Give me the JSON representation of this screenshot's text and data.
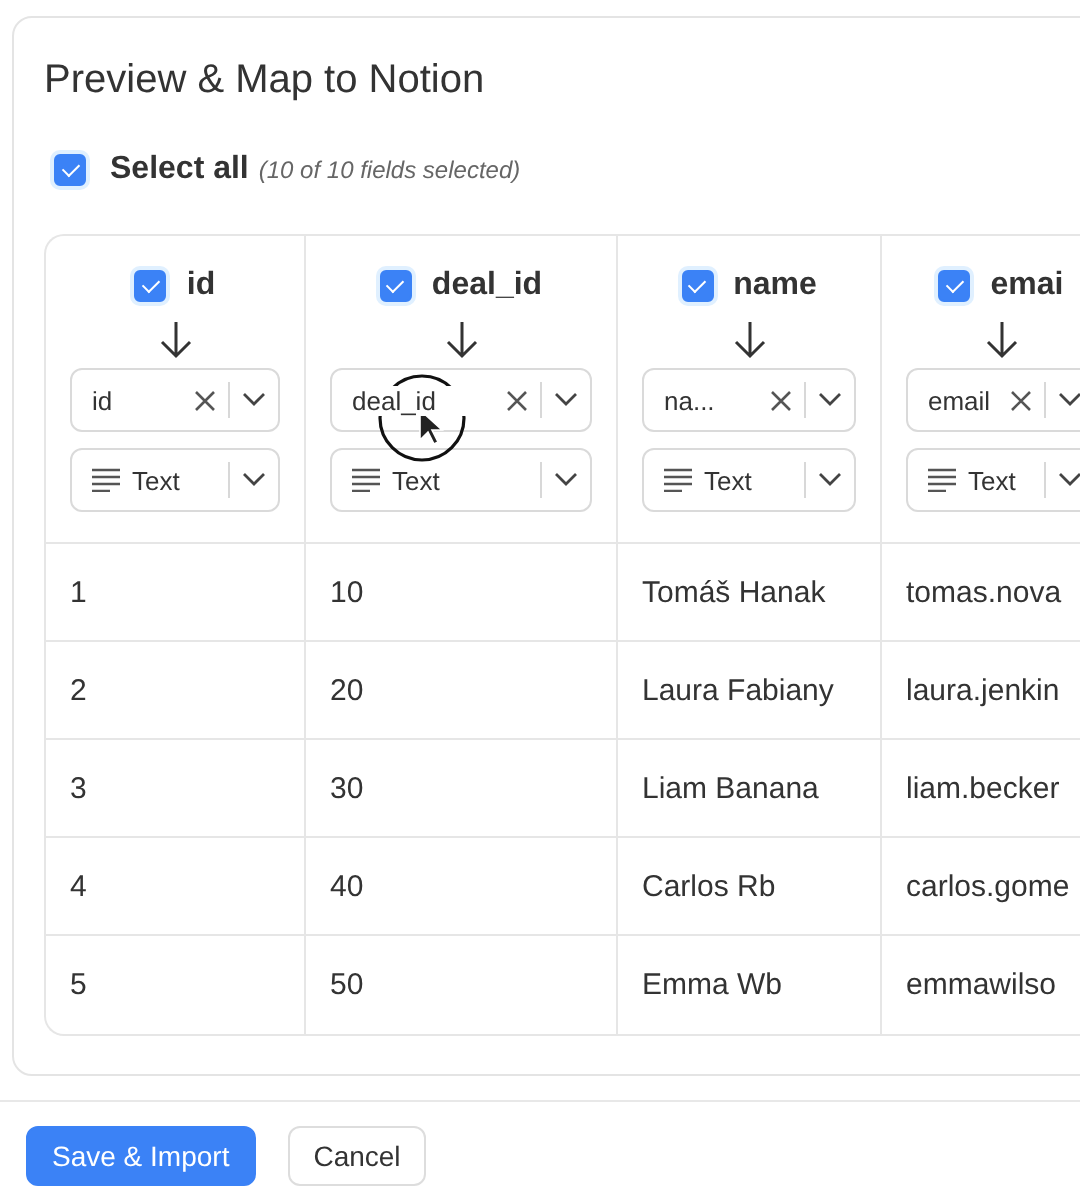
{
  "dialog": {
    "title": "Preview & Map to Notion"
  },
  "select_all": {
    "label": "Select all",
    "count": "(10 of 10 fields selected)",
    "checked": true
  },
  "columns": [
    {
      "header": "id",
      "checked": true,
      "mapping": "id",
      "type": "Text"
    },
    {
      "header": "deal_id",
      "checked": true,
      "mapping": "deal_id",
      "type": "Text"
    },
    {
      "header": "name",
      "checked": true,
      "mapping": "na...",
      "type": "Text"
    },
    {
      "header": "emai",
      "checked": true,
      "mapping": "email",
      "type": "Text"
    }
  ],
  "rows": [
    [
      "1",
      "10",
      "Tomáš Hanak",
      "tomas.nova"
    ],
    [
      "2",
      "20",
      "Laura Fabiany",
      "laura.jenkin"
    ],
    [
      "3",
      "30",
      "Liam Banana",
      "liam.becker"
    ],
    [
      "4",
      "40",
      "Carlos Rb",
      "carlos.gome"
    ],
    [
      "5",
      "50",
      "Emma Wb",
      "emmawilso"
    ]
  ],
  "buttons": [
    {
      "label": "Save & Import",
      "kind": "primary"
    },
    {
      "label": "Cancel",
      "kind": "secondary"
    }
  ]
}
